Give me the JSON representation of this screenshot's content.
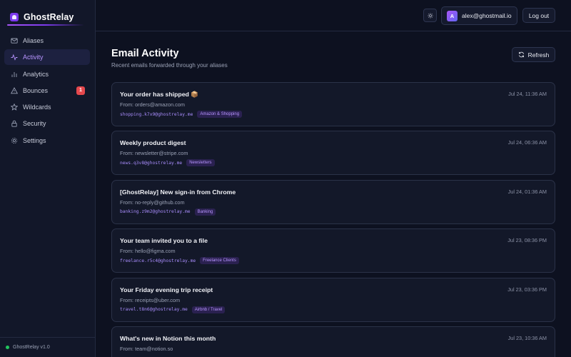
{
  "brand": {
    "name": "GhostRelay",
    "version": "GhostRelay v1.0",
    "accent": "#7c3aed"
  },
  "sidebar": {
    "items": [
      {
        "label": "Aliases",
        "icon": "mail-icon",
        "active": false
      },
      {
        "label": "Activity",
        "icon": "activity-icon",
        "active": true
      },
      {
        "label": "Analytics",
        "icon": "bar-chart-icon",
        "active": false
      },
      {
        "label": "Bounces",
        "icon": "warning-icon",
        "active": false,
        "badge": "1"
      },
      {
        "label": "Wildcards",
        "icon": "star-icon",
        "active": false
      },
      {
        "label": "Security",
        "icon": "lock-icon",
        "active": false
      },
      {
        "label": "Settings",
        "icon": "gear-icon",
        "active": false
      }
    ]
  },
  "header": {
    "avatar_letter": "A",
    "email": "alex@ghostmail.io",
    "logout_label": "Log out",
    "theme_icon": "sun-icon"
  },
  "main": {
    "title": "Email Activity",
    "subtitle": "Recent emails forwarded through your aliases",
    "refresh_label": "Refresh"
  },
  "emails": [
    {
      "subject": "Your order has shipped 📦",
      "from": "From: orders@amazon.com",
      "alias": "shopping.k7x9@ghostrelay.me",
      "tag": "Amazon & Shopping",
      "time": "Jul 24, 11:36 AM"
    },
    {
      "subject": "Weekly product digest",
      "from": "From: newsletter@stripe.com",
      "alias": "news.q3v8@ghostrelay.me",
      "tag": "Newsletters",
      "time": "Jul 24, 06:36 AM"
    },
    {
      "subject": "[GhostRelay] New sign-in from Chrome",
      "from": "From: no-reply@github.com",
      "alias": "banking.z9m2@ghostrelay.me",
      "tag": "Banking",
      "time": "Jul 24, 01:36 AM"
    },
    {
      "subject": "Your team invited you to a file",
      "from": "From: hello@figma.com",
      "alias": "freelance.r5c4@ghostrelay.me",
      "tag": "Freelance Clients",
      "time": "Jul 23, 08:36 PM"
    },
    {
      "subject": "Your Friday evening trip receipt",
      "from": "From: receipts@uber.com",
      "alias": "travel.t8n6@ghostrelay.me",
      "tag": "Airbnb / Travel",
      "time": "Jul 23, 03:36 PM"
    },
    {
      "subject": "What's new in Notion this month",
      "from": "From: team@notion.so",
      "alias": "",
      "tag": "",
      "time": "Jul 23, 10:36 AM"
    }
  ]
}
